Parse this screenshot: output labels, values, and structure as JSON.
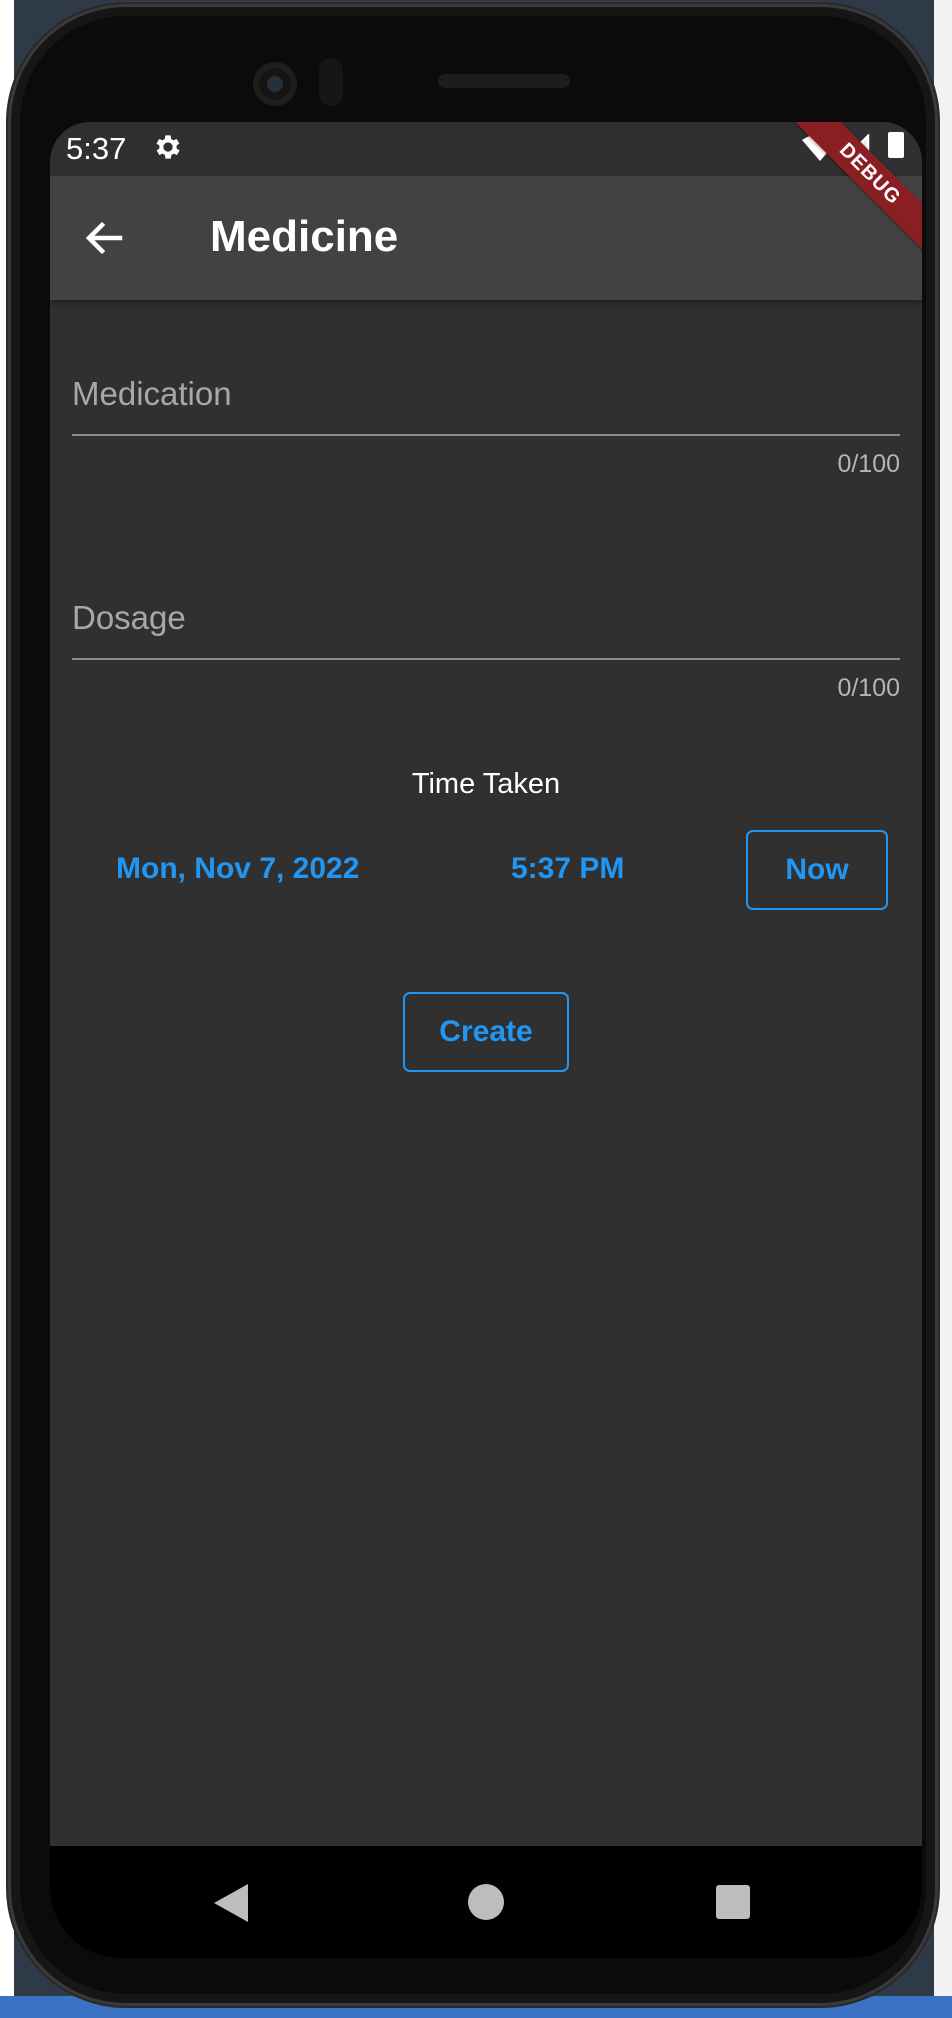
{
  "status_bar": {
    "time": "5:37",
    "icons": [
      "gear-icon",
      "wifi-icon",
      "signal-icon",
      "battery-icon"
    ]
  },
  "app_bar": {
    "title": "Medicine",
    "back_icon": "arrow-back-icon",
    "debug_banner": "DEBUG"
  },
  "form": {
    "medication": {
      "placeholder": "Medication",
      "value": "",
      "counter": "0/100"
    },
    "dosage": {
      "placeholder": "Dosage",
      "value": "",
      "counter": "0/100"
    },
    "time_taken_label": "Time Taken",
    "date": "Mon, Nov 7, 2022",
    "time": "5:37 PM",
    "now_label": "Now",
    "create_label": "Create"
  },
  "nav_bar": {
    "icons": [
      "nav-back-icon",
      "nav-home-icon",
      "nav-recents-icon"
    ]
  },
  "colors": {
    "accent": "#2196f3",
    "background": "#303030",
    "app_bar": "#424242",
    "debug_banner": "#8b1e22"
  }
}
